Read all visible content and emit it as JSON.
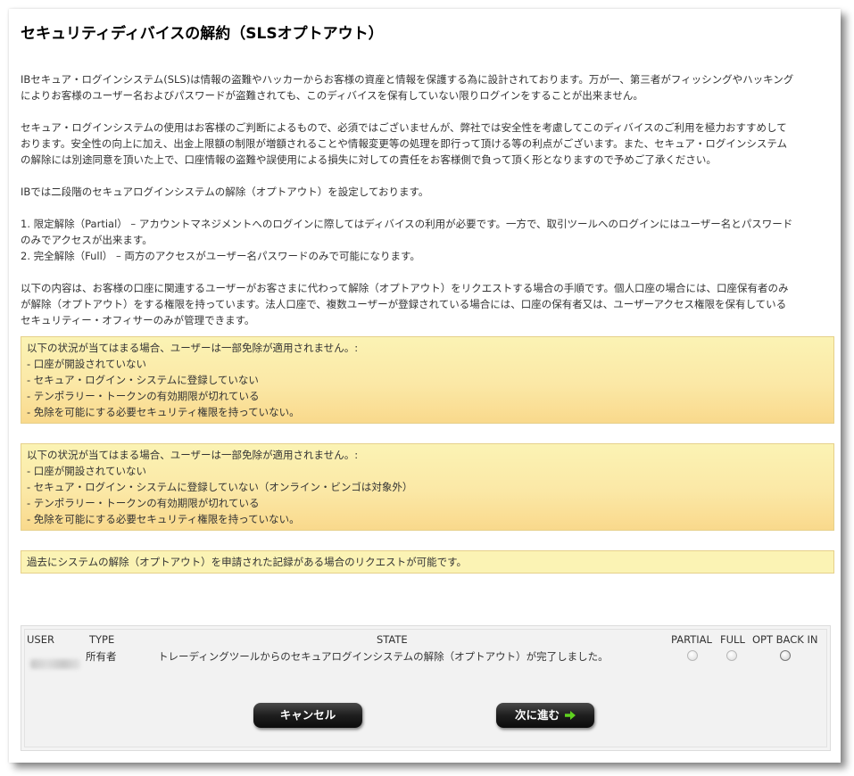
{
  "page": {
    "title": "セキュリティディバイスの解約（SLSオプトアウト）"
  },
  "paragraphs": {
    "p1": [
      "IBセキュア・ログインシステム(SLS)は情報の盗難やハッカーからお客様の資産と情報を保護する為に設計されております。万が一、第三者がフィッシングやハッキング",
      "によりお客様のユーザー名およびパスワードが盗難されても、このディバイスを保有していない限りログインをすることが出来ません。"
    ],
    "p2": [
      "セキュア・ログインシステムの使用はお客様のご判断によるもので、必須ではございませんが、弊社では安全性を考慮してこのディバイスのご利用を極力おすすめして",
      "おります。安全性の向上に加え、出金上限額の制限が増額されることや情報変更等の処理を即行って頂ける等の利点がございます。また、セキュア・ログインシステム",
      "の解除には別途同意を頂いた上で、口座情報の盗難や誤使用による損失に対しての責任をお客様側で負って頂く形となりますので予めご了承ください。"
    ],
    "p3": [
      "IBでは二段階のセキュアログインシステムの解除（オプトアウト）を設定しております。"
    ],
    "p4": [
      "1. 限定解除（Partial） – アカウントマネジメントへのログインに際してはディバイスの利用が必要です。一方で、取引ツールへのログインにはユーザー名とパスワード",
      "のみでアクセスが出来ます。",
      "2. 完全解除（Full） – 両方のアクセスがユーザー名パスワードのみで可能になります。"
    ],
    "p5": [
      "以下の内容は、お客様の口座に関連するユーザーがお客さまに代わって解除（オプトアウト）をリクエストする場合の手順です。個人口座の場合には、口座保有者のみ",
      "が解除（オプトアウト）をする権限を持っています。法人口座で、複数ユーザーが登録されている場合には、口座の保有者又は、ユーザーアクセス権限を保有している",
      "セキュリティー・オフィサーのみが管理できます。"
    ]
  },
  "notices": {
    "n1": [
      "以下の状況が当てはまる場合、ユーザーは一部免除が適用されません。:",
      "- 口座が開設されていない",
      "- セキュア・ログイン・システムに登録していない",
      "- テンポラリー・トークンの有効期限が切れている",
      "- 免除を可能にする必要セキュリティ権限を持っていない。"
    ],
    "n2": [
      "以下の状況が当てはまる場合、ユーザーは一部免除が適用されません。:",
      "- 口座が開設されていない",
      "- セキュア・ログイン・システムに登録していない（オンライン・ビンゴは対象外）",
      "- テンポラリー・トークンの有効期限が切れている",
      "- 免除を可能にする必要セキュリティ権限を持っていない。"
    ],
    "n3": [
      "過去にシステムの解除（オプトアウト）を申請された記録がある場合のリクエストが可能です。"
    ]
  },
  "table": {
    "headers": {
      "user": "USER",
      "type": "TYPE",
      "state": "STATE",
      "partial": "PARTIAL",
      "full": "FULL",
      "opt_back_in": "OPT BACK IN"
    },
    "row": {
      "type": "所有者",
      "state": "トレーディングツールからのセキュアログインシステムの解除（オプトアウト）が完了しました。",
      "partial_selected": false,
      "full_selected": false,
      "opt_back_in_selected": false
    }
  },
  "buttons": {
    "cancel": "キャンセル",
    "next": "次に進む"
  },
  "colors": {
    "notice_bg": "#fbf3b4",
    "notice_border": "#e6d08a",
    "arrow_green": "#5fd21f"
  }
}
